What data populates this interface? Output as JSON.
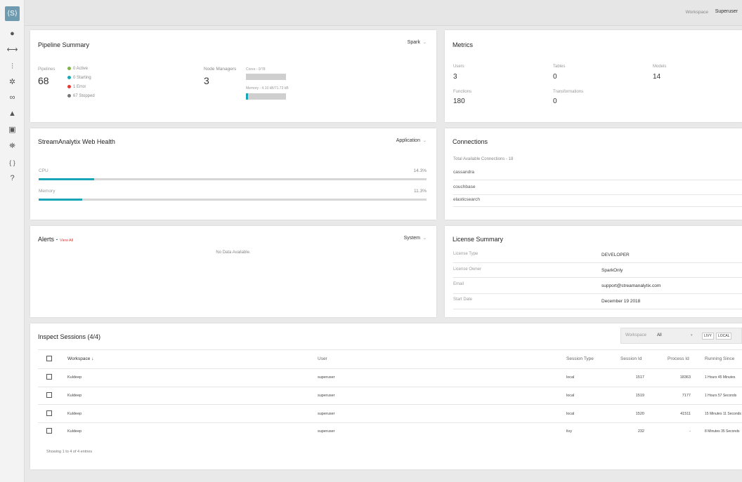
{
  "topbar": {
    "workspace_label": "Workspace",
    "user": "Superuser"
  },
  "sidebar": {
    "logo": "⟨S⟩",
    "icons": [
      "user-icon",
      "pipeline-icon",
      "sliders-icon",
      "gear-icon",
      "link-icon",
      "bell-icon",
      "report-icon",
      "group-icon",
      "braces-icon",
      "help-icon"
    ],
    "glyphs": [
      "●",
      "⟷",
      "⫶",
      "✲",
      "∞",
      "▲",
      "▣",
      "⛯",
      "{ }",
      "?"
    ]
  },
  "pipeline": {
    "title": "Pipeline Summary",
    "dropdown": "Spark",
    "pipelines_label": "Pipelines",
    "pipelines_count": "68",
    "statuses": [
      {
        "label": "0 Active",
        "color": "#7cb342"
      },
      {
        "label": "0 Starting",
        "color": "#1aa8b8"
      },
      {
        "label": "1 Error",
        "color": "#e53935"
      },
      {
        "label": "67 Stopped",
        "color": "#777777"
      }
    ],
    "node_managers_label": "Node Managers",
    "node_managers_count": "3",
    "cores_label": "Cores - 0/78",
    "memory_label": "Memory - 4.10 kB/71.73 kB",
    "memory_fraction": 0.06
  },
  "metrics": {
    "title": "Metrics",
    "items": [
      {
        "label": "Users",
        "value": "3"
      },
      {
        "label": "Tables",
        "value": "0"
      },
      {
        "label": "Models",
        "value": "14"
      },
      {
        "label": "Functions",
        "value": "180"
      },
      {
        "label": "Transformations",
        "value": "0"
      }
    ]
  },
  "health": {
    "title": "StreamAnalytix Web Health",
    "dropdown": "Application",
    "cpu_label": "CPU",
    "cpu_value": "14.3%",
    "cpu_fraction": 0.143,
    "memory_label": "Memory",
    "memory_value": "11.3%",
    "memory_fraction": 0.113
  },
  "connections": {
    "title": "Connections",
    "total": "Total Available Connections - 18",
    "items": [
      "cassandra",
      "couchbase",
      "elasticsearch"
    ]
  },
  "alerts": {
    "title": "Alerts - ",
    "view_all": "View All",
    "dropdown": "System",
    "empty": "No Data Available."
  },
  "license": {
    "title": "License Summary",
    "rows": [
      {
        "label": "License Type",
        "value": "DEVELOPER"
      },
      {
        "label": "License Owner",
        "value": "SparkOnly"
      },
      {
        "label": "Email",
        "value": "support@streamanalytix.com"
      },
      {
        "label": "Start Date",
        "value": "December 19 2018"
      }
    ]
  },
  "sessions": {
    "title": "Inspect Sessions (4/4)",
    "filter_label": "Workspace",
    "filter_value": "All",
    "pill_livy": "LIVY",
    "pill_local": "LOCAL",
    "columns": [
      "Workspace ↓",
      "User",
      "Session Type",
      "Session Id",
      "Process Id",
      "Running Since"
    ],
    "rows": [
      [
        "Kuldeep",
        "superuser",
        "local",
        "1517",
        "18363",
        "1 Hours 45 Minutes"
      ],
      [
        "Kuldeep",
        "superuser",
        "local",
        "1519",
        "7177",
        "1 Hours 57 Seconds"
      ],
      [
        "Kuldeep",
        "superuser",
        "local",
        "1520",
        "41511",
        "15 Minutes 11 Seconds"
      ],
      [
        "Kuldeep",
        "superuser",
        "livy",
        "232",
        "-",
        "8 Minutes 35 Seconds"
      ]
    ],
    "footer": "Showing 1 to 4 of 4 entries"
  }
}
